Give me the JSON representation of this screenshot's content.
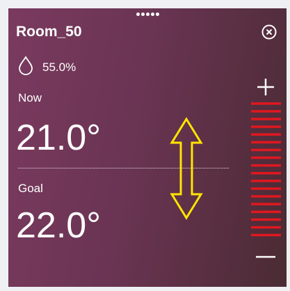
{
  "header": {
    "title": "Room_50"
  },
  "humidity": {
    "value": "55.0%",
    "icon": "water-drop-icon"
  },
  "now": {
    "label": "Now",
    "temperature": "21.0°"
  },
  "goal": {
    "label": "Goal",
    "temperature": "22.0°"
  },
  "setpoint_ladder": {
    "segments": 18
  },
  "colors": {
    "panel_gradient_start": "#7a3a5f",
    "panel_gradient_end": "#4a2b33",
    "text": "#ffffff",
    "ladder": "#e0171f",
    "drag_arrow": "#ffe500"
  }
}
